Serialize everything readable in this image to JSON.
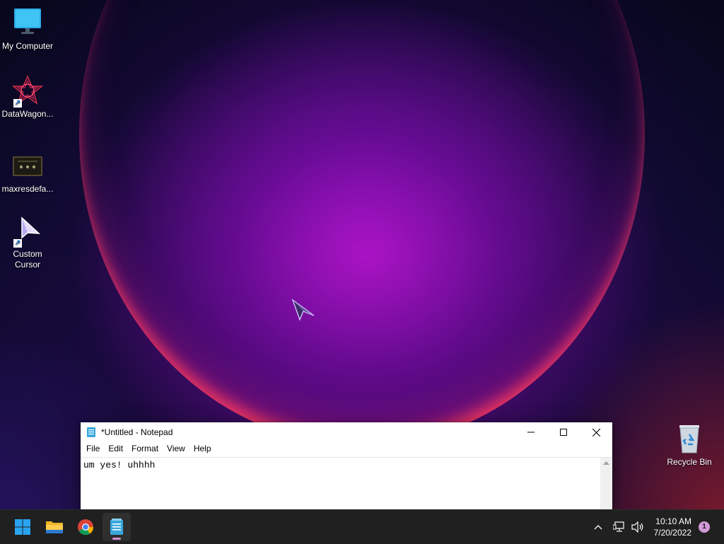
{
  "desktop": {
    "icons": [
      {
        "label": "My Computer",
        "icon": "monitor-icon"
      },
      {
        "label": "DataWagon...",
        "icon": "datawagon-logo-icon"
      },
      {
        "label": "maxresdefa...",
        "icon": "image-thumbnail-icon"
      },
      {
        "label": "Custom Cursor",
        "icon": "cursor-arrow-icon"
      },
      {
        "label": "Recycle Bin",
        "icon": "recycle-bin-icon"
      }
    ]
  },
  "notepad": {
    "title": "*Untitled - Notepad",
    "menu": [
      "File",
      "Edit",
      "Format",
      "View",
      "Help"
    ],
    "content": "um yes! uhhhh"
  },
  "taskbar": {
    "apps": [
      {
        "name": "Start",
        "icon": "windows-start-icon"
      },
      {
        "name": "File Explorer",
        "icon": "folder-icon"
      },
      {
        "name": "Google Chrome",
        "icon": "chrome-icon"
      },
      {
        "name": "Notepad",
        "icon": "notepad-icon",
        "active": true
      }
    ],
    "tray": {
      "icons": [
        "chevron-up-icon",
        "network-icon",
        "volume-icon"
      ],
      "time": "10:10 AM",
      "date": "7/20/2022",
      "notification_count": "1"
    }
  },
  "colors": {
    "taskbar_bg": "#202020",
    "accent": "#d29ad8",
    "window_bg": "#ffffff"
  }
}
